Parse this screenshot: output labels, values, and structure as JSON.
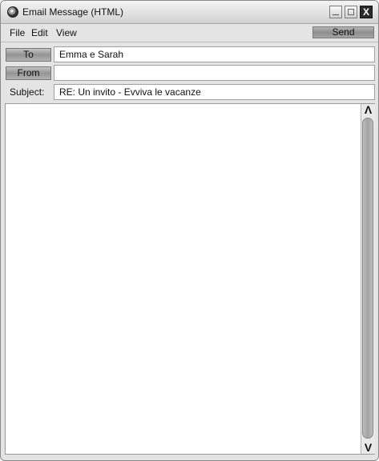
{
  "window": {
    "title": "Email Message (HTML)",
    "controls": {
      "minimize": "_",
      "maximize": "□",
      "close": "X"
    }
  },
  "menu": {
    "file": "File",
    "edit": "Edit",
    "view": "View"
  },
  "toolbar": {
    "send_label": "Send"
  },
  "fields": {
    "to_label": "To",
    "to_value": "Emma e Sarah",
    "from_label": "From",
    "from_value": "",
    "subject_label": "Subject:",
    "subject_value": "RE: Un invito - Evviva le vacanze"
  },
  "body": {
    "content": ""
  },
  "scrollbar": {
    "up": "Λ",
    "down": "V"
  }
}
